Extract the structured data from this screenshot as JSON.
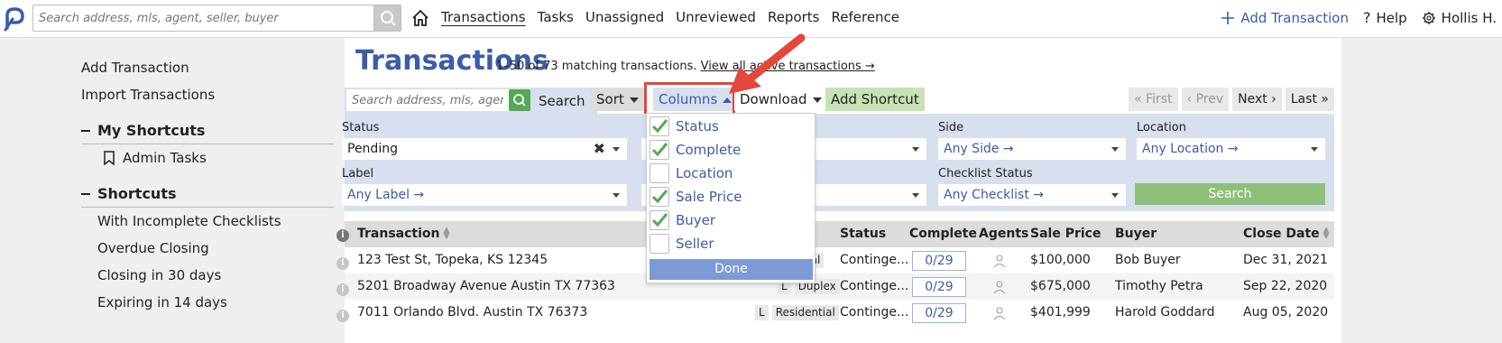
{
  "topbar": {
    "search_placeholder": "Search address, mls, agent, seller, buyer",
    "nav": [
      "Transactions",
      "Tasks",
      "Unassigned",
      "Unreviewed",
      "Reports",
      "Reference"
    ],
    "add_transaction": "Add Transaction",
    "help": "Help",
    "user": "Hollis H."
  },
  "sidebar": {
    "links": [
      "Add Transaction",
      "Import Transactions"
    ],
    "my_shortcuts_title": "My Shortcuts",
    "my_shortcuts": [
      "Admin Tasks"
    ],
    "shortcuts_title": "Shortcuts",
    "shortcuts": [
      "With Incomplete Checklists",
      "Overdue Closing",
      "Closing in 30 days",
      "Expiring in 14 days"
    ]
  },
  "main": {
    "title": "Transactions",
    "match_text": "1–50 of 73 matching transactions.",
    "view_all": "View all active transactions →",
    "search_placeholder": "Search address, mls, agent, seller, buyer",
    "search_label": "Search",
    "sort": "Sort",
    "columns": "Columns",
    "download": "Download",
    "add_shortcut": "Add Shortcut",
    "pager": [
      "« First",
      "‹ Prev",
      "Next ›",
      "Last »"
    ]
  },
  "filters": {
    "status_label": "Status",
    "status_value": "Pending",
    "side_label": "Side",
    "side_value": "Any Side →",
    "location_label": "Location",
    "location_value": "Any Location →",
    "label_label": "Label",
    "label_value": "Any Label →",
    "checklist_label": "Checklist Status",
    "checklist_value": "Any Checklist →",
    "search_button": "Search"
  },
  "table": {
    "headers": [
      "Transaction",
      "Status",
      "Complete",
      "Agents",
      "Sale Price",
      "Buyer",
      "Close Date"
    ],
    "rows": [
      {
        "address": "123 Test St, Topeka, KS 12345",
        "type_letter": "",
        "type": "ntial",
        "status": "Continge...",
        "complete": "0/29",
        "price": "$100,000",
        "buyer": "Bob Buyer",
        "close": "Dec 31, 2021"
      },
      {
        "address": "5201 Broadway Avenue Austin TX 77363",
        "type_letter": "L",
        "type": "Duplex",
        "status": "Continge...",
        "complete": "0/29",
        "price": "$675,000",
        "buyer": "Timothy Petra",
        "close": "Sep 22, 2020"
      },
      {
        "address": "7011 Orlando Blvd. Austin TX 76373",
        "type_letter": "L",
        "type": "Residential",
        "status": "Continge...",
        "complete": "0/29",
        "price": "$401,999",
        "buyer": "Harold Goddard",
        "close": "Aug 05, 2020"
      }
    ]
  },
  "columns_dropdown": {
    "options": [
      {
        "label": "Status",
        "checked": true
      },
      {
        "label": "Complete",
        "checked": true
      },
      {
        "label": "Location",
        "checked": false
      },
      {
        "label": "Sale Price",
        "checked": true
      },
      {
        "label": "Buyer",
        "checked": true
      },
      {
        "label": "Seller",
        "checked": false
      }
    ],
    "done": "Done"
  },
  "colors": {
    "accent": "#3b5ca8",
    "filter_bg": "#d8dfee",
    "check_green": "#54a955",
    "annotation_red": "#e2483b"
  }
}
